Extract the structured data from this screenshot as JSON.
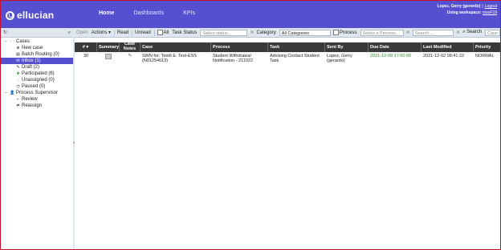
{
  "header": {
    "logo_text": "ellucian",
    "nav": [
      {
        "label": "Home",
        "active": true
      },
      {
        "label": "Dashboards",
        "active": false
      },
      {
        "label": "KPIs",
        "active": false
      }
    ],
    "user_name": "Lopez, Gerry (gerardo)",
    "logout": "Logout",
    "workspace_prefix": "Using workspace:",
    "workspace": "msoF19",
    "brand_color": "#5650d1"
  },
  "sidebar": {
    "groups": [
      {
        "label": "Cases",
        "items": [
          {
            "label": "New case"
          },
          {
            "label": "Batch Routing (0)"
          },
          {
            "label": "Inbox (1)",
            "selected": true
          },
          {
            "label": "Draft (2)"
          },
          {
            "label": "Participated (6)"
          },
          {
            "label": "Unassigned (0)"
          },
          {
            "label": "Paused (0)"
          }
        ]
      },
      {
        "label": "Process Supervisor",
        "items": [
          {
            "label": "Review"
          },
          {
            "label": "Reassign"
          }
        ]
      }
    ]
  },
  "toolbar": {
    "open": "Open",
    "actions": "Actions",
    "read": "Read",
    "unread": "Unread",
    "all": "All",
    "task_status_label": "Task Status",
    "task_status_placeholder": "Select status...",
    "category_label": "Category",
    "category_value": "All Categories",
    "process_label": "Process",
    "process_placeholder": "Select a Process...",
    "search_placeholder": "Search ...",
    "search_button": "Search",
    "case_id_placeholder": "Case Id"
  },
  "table": {
    "columns": [
      "#",
      "Summary",
      "Case Notes",
      "Case",
      "Process",
      "Task",
      "Sent By",
      "Due Date",
      "Last Modified",
      "Priority"
    ],
    "rows": [
      {
        "num": "30",
        "case": "SWN for: Test6 E. Test-ESS (N01254613)",
        "process": "Student Withdrawal Notification - 211022",
        "task": "Advising Contact Student Task",
        "sent_by": "Lopez, Gerry (gerardo)",
        "due_date": "2021-12-08 17:00:00",
        "last_modified": "2021-12-02 08:41:22",
        "priority": "NORMAL"
      }
    ]
  }
}
